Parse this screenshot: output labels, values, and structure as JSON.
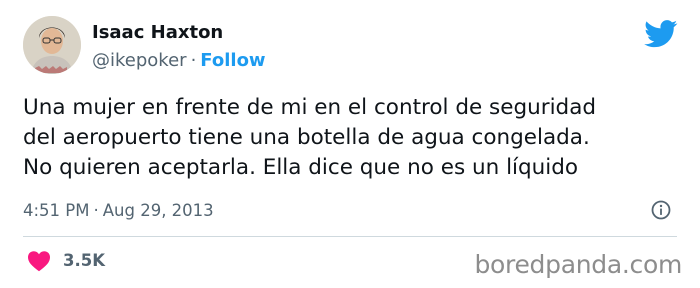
{
  "author": {
    "name": "Isaac Haxton",
    "handle": "@ikepoker",
    "separator": "·",
    "follow_label": "Follow",
    "avatar_icon": "profile-photo"
  },
  "brand": {
    "icon": "twitter-bird-icon",
    "color": "#1d9bf0"
  },
  "tweet": {
    "lines": [
      "Una mujer en frente de mi en el control de seguridad",
      "del aeropuerto tiene una botella de agua congelada.",
      "No quieren aceptarla. Ella dice que no es un líquido"
    ],
    "time": "4:51 PM",
    "separator": "·",
    "date": "Aug 29, 2013"
  },
  "engagement": {
    "likes": "3.5K",
    "like_icon": "heart-icon",
    "like_color": "#f91880"
  },
  "watermark": "boredpanda.com"
}
